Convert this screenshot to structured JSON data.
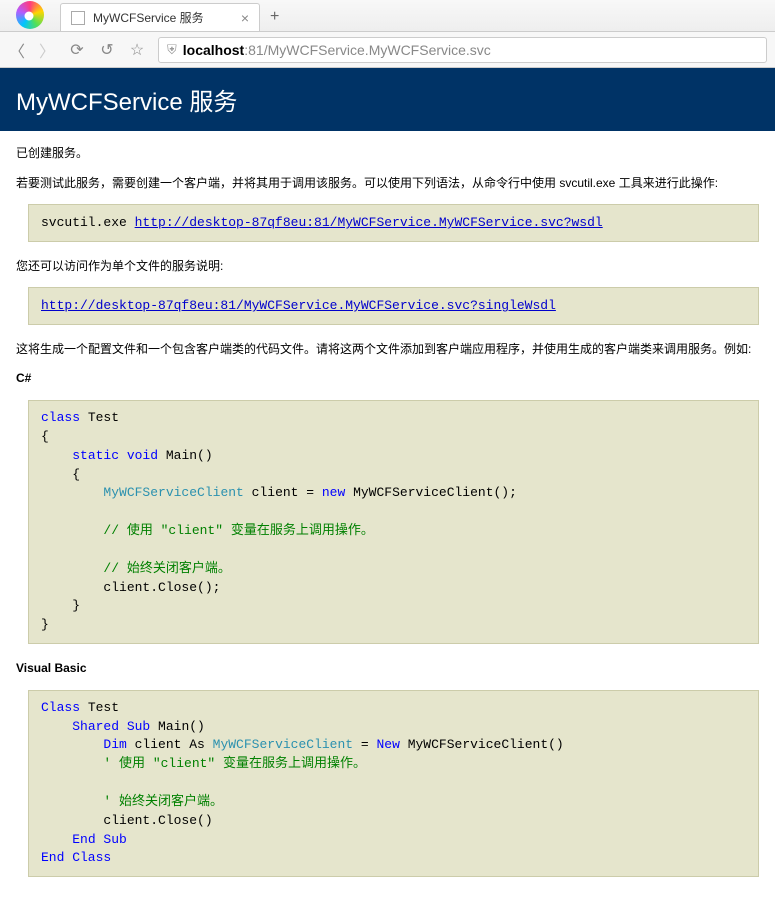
{
  "browser": {
    "tab_title": "MyWCFService 服务",
    "url_host": "localhost",
    "url_rest": ":81/MyWCFService.MyWCFService.svc"
  },
  "header": {
    "title": "MyWCFService 服务"
  },
  "body": {
    "p1": "已创建服务。",
    "p2": "若要测试此服务，需要创建一个客户端，并将其用于调用该服务。可以使用下列语法，从命令行中使用 svcutil.exe 工具来进行此操作:",
    "cmd_prefix": "svcutil.exe ",
    "wsdl_link": "http://desktop-87qf8eu:81/MyWCFService.MyWCFService.svc?wsdl",
    "p3": "您还可以访问作为单个文件的服务说明:",
    "single_wsdl_link": "http://desktop-87qf8eu:81/MyWCFService.MyWCFService.svc?singleWsdl",
    "p4": "这将生成一个配置文件和一个包含客户端类的代码文件。请将这两个文件添加到客户端应用程序，并使用生成的客户端类来调用服务。例如:"
  },
  "csharp": {
    "heading": "C#",
    "code": {
      "kw_class": "class",
      "t_test": " Test",
      "brace_open": "{",
      "indent1": "    ",
      "kw_static": "static",
      "kw_void": " void",
      "t_main": " Main()",
      "indent2": "        ",
      "typ_client": "MyWCFServiceClient",
      "t_clientvar": " client = ",
      "kw_new": "new",
      "t_ctor": " MyWCFServiceClient();",
      "com1": "// 使用 \"client\" 变量在服务上调用操作。",
      "com2": "// 始终关闭客户端。",
      "t_close": "client.Close();",
      "brace_close": "}"
    }
  },
  "vb": {
    "heading": "Visual Basic",
    "code": {
      "kw_class": "Class",
      "t_test": " Test",
      "indent1": "    ",
      "kw_sharedsub": "Shared Sub",
      "t_main": " Main()",
      "indent2": "        ",
      "kw_dim": "Dim",
      "t_clientas": " client As ",
      "typ_client": "MyWCFServiceClient",
      "t_eq": " = ",
      "kw_new": "New",
      "t_ctor": " MyWCFServiceClient()",
      "com1": "' 使用 \"client\" 变量在服务上调用操作。",
      "com2": "' 始终关闭客户端。",
      "t_close": "client.Close()",
      "kw_endsub": "End Sub",
      "kw_endclass": "End Class"
    }
  }
}
